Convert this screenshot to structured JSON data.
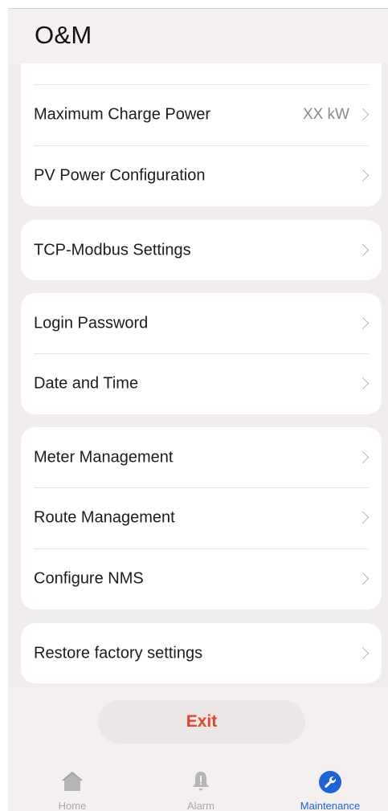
{
  "header": {
    "title": "O&M"
  },
  "settings": {
    "groups": [
      {
        "items": [
          {
            "label": "Maximum Charge Power",
            "value": "XX kW"
          },
          {
            "label": "PV Power Configuration",
            "value": ""
          }
        ]
      },
      {
        "items": [
          {
            "label": "TCP-Modbus Settings",
            "value": ""
          }
        ]
      },
      {
        "items": [
          {
            "label": "Login Password",
            "value": ""
          },
          {
            "label": "Date and Time",
            "value": ""
          }
        ]
      },
      {
        "items": [
          {
            "label": "Meter Management",
            "value": ""
          },
          {
            "label": "Route Management",
            "value": ""
          },
          {
            "label": "Configure NMS",
            "value": ""
          }
        ]
      },
      {
        "items": [
          {
            "label": "Restore factory settings",
            "value": ""
          }
        ]
      }
    ]
  },
  "exit": {
    "label": "Exit"
  },
  "tabbar": {
    "active": "maintenance",
    "tabs": [
      {
        "id": "home",
        "label": "Home",
        "icon": "home-icon"
      },
      {
        "id": "alarm",
        "label": "Alarm",
        "icon": "bell-icon"
      },
      {
        "id": "maintenance",
        "label": "Maintenance",
        "icon": "wrench-icon"
      }
    ]
  },
  "colors": {
    "accent": "#1f63d6",
    "exit": "#e0452b",
    "background": "#f5f0f0",
    "card": "#ffffff"
  }
}
